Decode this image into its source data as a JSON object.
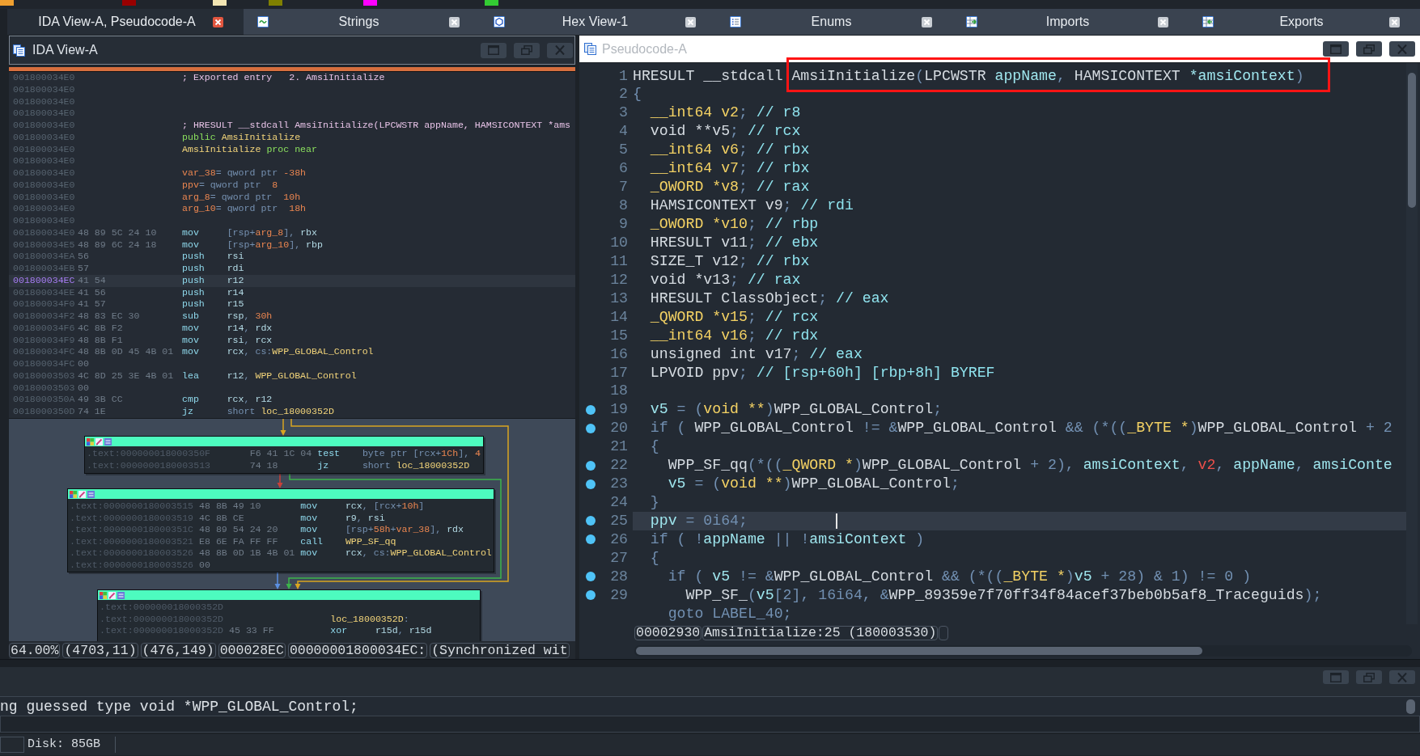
{
  "legend": [
    {
      "color": "#f0a030"
    },
    {
      "color": "#990000"
    },
    {
      "color": "#f3e6b3"
    },
    {
      "color": "#808000"
    },
    {
      "color": "#ff00ff"
    },
    {
      "color": "#33cc33"
    }
  ],
  "tabs": [
    {
      "label": "IDA View-A, Pseudocode-A",
      "kind": "plain",
      "selected": true
    },
    {
      "label": "Strings",
      "kind": "strings",
      "selected": false
    },
    {
      "label": "Hex View-1",
      "kind": "hex",
      "selected": false
    },
    {
      "label": "Enums",
      "kind": "enums",
      "selected": false
    },
    {
      "label": "Imports",
      "kind": "imports",
      "selected": false
    },
    {
      "label": "Exports",
      "kind": "exports",
      "selected": false
    }
  ],
  "disassembly": {
    "title": "IDA View-A",
    "listing": [
      {
        "address": "001800034E0",
        "code": [
          {
            "kind": "comment",
            "text": "; Exported entry   2. AmsiInitialize"
          }
        ],
        "selected": false
      },
      {
        "address": "001800034E0",
        "selected": false
      },
      {
        "address": "001800034E0",
        "selected": false
      },
      {
        "address": "001800034E0",
        "selected": false
      },
      {
        "address": "001800034E0",
        "code": [
          {
            "kind": "comment",
            "text": "; HRESULT __stdcall AmsiInitialize(LPCWSTR appName, HAMSICONTEXT *ams"
          }
        ],
        "selected": false
      },
      {
        "address": "001800034E0",
        "code": [
          {
            "kind": "dir",
            "text": "public "
          },
          {
            "kind": "name",
            "text": "AmsiInitialize"
          }
        ],
        "selected": false
      },
      {
        "address": "001800034E0",
        "code": [
          {
            "kind": "name",
            "text": "AmsiInitialize "
          },
          {
            "kind": "dir",
            "text": "proc near"
          }
        ],
        "selected": false
      },
      {
        "address": "001800034E0",
        "selected": false
      },
      {
        "address": "001800034E0",
        "code": [
          {
            "kind": "num",
            "text": "var_38"
          },
          {
            "kind": "kw",
            "text": "= qword ptr "
          },
          {
            "kind": "num",
            "text": "-38h"
          }
        ],
        "selected": false
      },
      {
        "address": "001800034E0",
        "code": [
          {
            "kind": "num",
            "text": "ppv"
          },
          {
            "kind": "kw",
            "text": "= qword ptr  "
          },
          {
            "kind": "num",
            "text": "8"
          }
        ],
        "selected": false
      },
      {
        "address": "001800034E0",
        "code": [
          {
            "kind": "num",
            "text": "arg_8"
          },
          {
            "kind": "kw",
            "text": "= qword ptr  "
          },
          {
            "kind": "num",
            "text": "10h"
          }
        ],
        "selected": false
      },
      {
        "address": "001800034E0",
        "code": [
          {
            "kind": "num",
            "text": "arg_10"
          },
          {
            "kind": "kw",
            "text": "= qword ptr  "
          },
          {
            "kind": "num",
            "text": "18h"
          }
        ],
        "selected": false
      },
      {
        "address": "001800034E0",
        "selected": false
      },
      {
        "address": "001800034E0",
        "bytes": "48 89 5C 24 10",
        "code": [
          {
            "kind": "mnem",
            "text": "mov"
          },
          {
            "kind": "kw",
            "text": "[rsp+"
          },
          {
            "kind": "num",
            "text": "arg_8"
          },
          {
            "kind": "kw",
            "text": "], "
          },
          {
            "kind": "reg",
            "text": "rbx"
          }
        ],
        "selected": false
      },
      {
        "address": "001800034E5",
        "bytes": "48 89 6C 24 18",
        "code": [
          {
            "kind": "mnem",
            "text": "mov"
          },
          {
            "kind": "kw",
            "text": "[rsp+"
          },
          {
            "kind": "num",
            "text": "arg_10"
          },
          {
            "kind": "kw",
            "text": "], "
          },
          {
            "kind": "reg",
            "text": "rbp"
          }
        ],
        "selected": false
      },
      {
        "address": "001800034EA",
        "bytes": "56",
        "code": [
          {
            "kind": "mnem",
            "text": "push"
          },
          {
            "kind": "reg",
            "text": "rsi"
          }
        ],
        "selected": false
      },
      {
        "address": "001800034EB",
        "bytes": "57",
        "code": [
          {
            "kind": "mnem",
            "text": "push"
          },
          {
            "kind": "reg",
            "text": "rdi"
          }
        ],
        "selected": false
      },
      {
        "address": "001800034EC",
        "bytes": "41 54",
        "code": [
          {
            "kind": "mnem",
            "text": "push"
          },
          {
            "kind": "reg",
            "text": "r12"
          }
        ],
        "selected": true
      },
      {
        "address": "001800034EE",
        "bytes": "41 56",
        "code": [
          {
            "kind": "mnem",
            "text": "push"
          },
          {
            "kind": "reg",
            "text": "r14"
          }
        ],
        "selected": false
      },
      {
        "address": "001800034F0",
        "bytes": "41 57",
        "code": [
          {
            "kind": "mnem",
            "text": "push"
          },
          {
            "kind": "reg",
            "text": "r15"
          }
        ],
        "selected": false
      },
      {
        "address": "001800034F2",
        "bytes": "48 83 EC 30",
        "code": [
          {
            "kind": "mnem",
            "text": "sub"
          },
          {
            "kind": "reg",
            "text": "rsp"
          },
          {
            "kind": "kw",
            "text": ", "
          },
          {
            "kind": "num",
            "text": "30h"
          }
        ],
        "selected": false
      },
      {
        "address": "001800034F6",
        "bytes": "4C 8B F2",
        "code": [
          {
            "kind": "mnem",
            "text": "mov"
          },
          {
            "kind": "reg",
            "text": "r14"
          },
          {
            "kind": "kw",
            "text": ", "
          },
          {
            "kind": "reg",
            "text": "rdx"
          }
        ],
        "selected": false
      },
      {
        "address": "001800034F9",
        "bytes": "48 8B F1",
        "code": [
          {
            "kind": "mnem",
            "text": "mov"
          },
          {
            "kind": "reg",
            "text": "rsi"
          },
          {
            "kind": "kw",
            "text": ", "
          },
          {
            "kind": "reg",
            "text": "rcx"
          }
        ],
        "selected": false
      },
      {
        "address": "001800034FC",
        "bytes": "48 8B 0D 45 4B 01",
        "code": [
          {
            "kind": "mnem",
            "text": "mov"
          },
          {
            "kind": "reg",
            "text": "rcx"
          },
          {
            "kind": "kw",
            "text": ", cs:"
          },
          {
            "kind": "name",
            "text": "WPP_GLOBAL_Control"
          }
        ],
        "selected": false
      },
      {
        "address": "001800034FC",
        "bytes": "00",
        "selected": false
      },
      {
        "address": "00180003503",
        "bytes": "4C 8D 25 3E 4B 01",
        "code": [
          {
            "kind": "mnem",
            "text": "lea"
          },
          {
            "kind": "reg",
            "text": "r12"
          },
          {
            "kind": "kw",
            "text": ", "
          },
          {
            "kind": "name",
            "text": "WPP_GLOBAL_Control"
          }
        ],
        "selected": false
      },
      {
        "address": "00180003503",
        "bytes": "00",
        "selected": false
      },
      {
        "address": "0018000350A",
        "bytes": "49 3B CC",
        "code": [
          {
            "kind": "mnem",
            "text": "cmp"
          },
          {
            "kind": "reg",
            "text": "rcx"
          },
          {
            "kind": "kw",
            "text": ", "
          },
          {
            "kind": "reg",
            "text": "r12"
          }
        ],
        "selected": false
      },
      {
        "address": "0018000350D",
        "bytes": "74 1E",
        "code": [
          {
            "kind": "mnem",
            "text": "jz"
          },
          {
            "kind": "kw",
            "text": "short "
          },
          {
            "kind": "name",
            "text": "loc_18000352D"
          }
        ],
        "selected": false
      }
    ],
    "graph": {
      "blocks": [
        {
          "lines": [
            {
              "address": ".text:000000018000350F",
              "bytes": "F6 41 1C 04",
              "code": [
                {
                  "kind": "mnem",
                  "text": "test"
                },
                {
                  "kind": "kw",
                  "text": "byte ptr [rcx+"
                },
                {
                  "kind": "num",
                  "text": "1Ch"
                },
                {
                  "kind": "kw",
                  "text": "], "
                },
                {
                  "kind": "num",
                  "text": "4"
                }
              ]
            },
            {
              "address": ".text:0000000180003513",
              "bytes": "74 18",
              "code": [
                {
                  "kind": "mnem",
                  "text": "jz"
                },
                {
                  "kind": "kw",
                  "text": "short "
                },
                {
                  "kind": "name",
                  "text": "loc_18000352D"
                }
              ]
            }
          ]
        },
        {
          "lines": [
            {
              "address": ".text:0000000180003515",
              "bytes": "48 8B 49 10",
              "code": [
                {
                  "kind": "mnem",
                  "text": "mov"
                },
                {
                  "kind": "reg",
                  "text": "rcx"
                },
                {
                  "kind": "kw",
                  "text": ", [rcx+"
                },
                {
                  "kind": "num",
                  "text": "10h"
                },
                {
                  "kind": "kw",
                  "text": "]"
                }
              ]
            },
            {
              "address": ".text:0000000180003519",
              "bytes": "4C 8B CE",
              "code": [
                {
                  "kind": "mnem",
                  "text": "mov"
                },
                {
                  "kind": "reg",
                  "text": "r9"
                },
                {
                  "kind": "kw",
                  "text": ", "
                },
                {
                  "kind": "reg",
                  "text": "rsi"
                }
              ]
            },
            {
              "address": ".text:000000018000351C",
              "bytes": "48 89 54 24 20",
              "code": [
                {
                  "kind": "mnem",
                  "text": "mov"
                },
                {
                  "kind": "kw",
                  "text": "[rsp+"
                },
                {
                  "kind": "num",
                  "text": "58h"
                },
                {
                  "kind": "kw",
                  "text": "+"
                },
                {
                  "kind": "num",
                  "text": "var_38"
                },
                {
                  "kind": "kw",
                  "text": "], "
                },
                {
                  "kind": "reg",
                  "text": "rdx"
                }
              ]
            },
            {
              "address": ".text:0000000180003521",
              "bytes": "E8 6E FA FF FF",
              "code": [
                {
                  "kind": "mnem",
                  "text": "call"
                },
                {
                  "kind": "name",
                  "text": "WPP_SF_qq"
                }
              ]
            },
            {
              "address": ".text:0000000180003526",
              "bytes": "48 8B 0D 1B 4B 01",
              "code": [
                {
                  "kind": "mnem",
                  "text": "mov"
                },
                {
                  "kind": "reg",
                  "text": "rcx"
                },
                {
                  "kind": "kw",
                  "text": ", cs:"
                },
                {
                  "kind": "name",
                  "text": "WPP_GLOBAL_Control"
                }
              ]
            },
            {
              "address": ".text:0000000180003526",
              "bytes": "00"
            }
          ]
        },
        {
          "lines": [
            {
              "address": ".text:000000018000352D"
            },
            {
              "address": ".text:000000018000352D",
              "code": [
                {
                  "kind": "name",
                  "text": "loc_18000352D"
                },
                {
                  "kind": "kw",
                  "text": ":"
                }
              ]
            },
            {
              "address": ".text:000000018000352D",
              "bytes": "45 33 FF",
              "code": [
                {
                  "kind": "mnem",
                  "text": "xor"
                },
                {
                  "kind": "reg",
                  "text": "r15d"
                },
                {
                  "kind": "kw",
                  "text": ", "
                },
                {
                  "kind": "reg",
                  "text": "r15d"
                }
              ]
            }
          ]
        }
      ]
    },
    "status": [
      "64.00%",
      "(4703,11)",
      "(476,149)",
      "000028EC",
      "00000001800034EC:",
      "(Synchronized wit"
    ]
  },
  "pseudocode": {
    "title": "Pseudocode-A",
    "lines": [
      {
        "number": "1",
        "marker": false,
        "selected": false,
        "code": [
          {
            "kind": "plain",
            "text": "HRESULT __stdcall AmsiInitialize"
          },
          {
            "kind": "op",
            "text": "("
          },
          {
            "kind": "plain",
            "text": "LPCWSTR "
          },
          {
            "kind": "var",
            "text": "appName"
          },
          {
            "kind": "op",
            "text": ", "
          },
          {
            "kind": "plain",
            "text": "HAMSICONTEXT "
          },
          {
            "kind": "var",
            "text": "*amsiContext"
          },
          {
            "kind": "op",
            "text": ")"
          }
        ]
      },
      {
        "number": "2",
        "marker": false,
        "selected": false,
        "code": [
          {
            "kind": "op",
            "text": "{"
          }
        ]
      },
      {
        "number": "3",
        "marker": false,
        "selected": false,
        "code": [
          {
            "kind": "type",
            "text": "  __int64 v2"
          },
          {
            "kind": "op",
            "text": "; "
          },
          {
            "kind": "comment",
            "text": "// r8"
          }
        ]
      },
      {
        "number": "4",
        "marker": false,
        "selected": false,
        "code": [
          {
            "kind": "plain",
            "text": "  void **v5"
          },
          {
            "kind": "op",
            "text": "; "
          },
          {
            "kind": "comment",
            "text": "// rcx"
          }
        ]
      },
      {
        "number": "5",
        "marker": false,
        "selected": false,
        "code": [
          {
            "kind": "type",
            "text": "  __int64 v6"
          },
          {
            "kind": "op",
            "text": "; "
          },
          {
            "kind": "comment",
            "text": "// rbx"
          }
        ]
      },
      {
        "number": "6",
        "marker": false,
        "selected": false,
        "code": [
          {
            "kind": "type",
            "text": "  __int64 v7"
          },
          {
            "kind": "op",
            "text": "; "
          },
          {
            "kind": "comment",
            "text": "// rbx"
          }
        ]
      },
      {
        "number": "7",
        "marker": false,
        "selected": false,
        "code": [
          {
            "kind": "type",
            "text": "  _OWORD *v8"
          },
          {
            "kind": "op",
            "text": "; "
          },
          {
            "kind": "comment",
            "text": "// rax"
          }
        ]
      },
      {
        "number": "8",
        "marker": false,
        "selected": false,
        "code": [
          {
            "kind": "plain",
            "text": "  HAMSICONTEXT v9"
          },
          {
            "kind": "op",
            "text": "; "
          },
          {
            "kind": "comment",
            "text": "// rdi"
          }
        ]
      },
      {
        "number": "9",
        "marker": false,
        "selected": false,
        "code": [
          {
            "kind": "type",
            "text": "  _OWORD *v10"
          },
          {
            "kind": "op",
            "text": "; "
          },
          {
            "kind": "comment",
            "text": "// rbp"
          }
        ]
      },
      {
        "number": "10",
        "marker": false,
        "selected": false,
        "code": [
          {
            "kind": "plain",
            "text": "  HRESULT v11"
          },
          {
            "kind": "op",
            "text": "; "
          },
          {
            "kind": "comment",
            "text": "// ebx"
          }
        ]
      },
      {
        "number": "11",
        "marker": false,
        "selected": false,
        "code": [
          {
            "kind": "plain",
            "text": "  SIZE_T v12"
          },
          {
            "kind": "op",
            "text": "; "
          },
          {
            "kind": "comment",
            "text": "// rbx"
          }
        ]
      },
      {
        "number": "12",
        "marker": false,
        "selected": false,
        "code": [
          {
            "kind": "plain",
            "text": "  void *v13"
          },
          {
            "kind": "op",
            "text": "; "
          },
          {
            "kind": "comment",
            "text": "// rax"
          }
        ]
      },
      {
        "number": "13",
        "marker": false,
        "selected": false,
        "code": [
          {
            "kind": "plain",
            "text": "  HRESULT ClassObject"
          },
          {
            "kind": "op",
            "text": "; "
          },
          {
            "kind": "comment",
            "text": "// eax"
          }
        ]
      },
      {
        "number": "14",
        "marker": false,
        "selected": false,
        "code": [
          {
            "kind": "type",
            "text": "  _QWORD *v15"
          },
          {
            "kind": "op",
            "text": "; "
          },
          {
            "kind": "comment",
            "text": "// rcx"
          }
        ]
      },
      {
        "number": "15",
        "marker": false,
        "selected": false,
        "code": [
          {
            "kind": "type",
            "text": "  __int64 v16"
          },
          {
            "kind": "op",
            "text": "; "
          },
          {
            "kind": "comment",
            "text": "// rdx"
          }
        ]
      },
      {
        "number": "16",
        "marker": false,
        "selected": false,
        "code": [
          {
            "kind": "plain",
            "text": "  unsigned int v17"
          },
          {
            "kind": "op",
            "text": "; "
          },
          {
            "kind": "comment",
            "text": "// eax"
          }
        ]
      },
      {
        "number": "17",
        "marker": false,
        "selected": false,
        "code": [
          {
            "kind": "plain",
            "text": "  LPVOID ppv"
          },
          {
            "kind": "op",
            "text": "; "
          },
          {
            "kind": "comment",
            "text": "// [rsp+60h] [rbp+8h] BYREF"
          }
        ]
      },
      {
        "number": "18",
        "marker": false,
        "selected": false
      },
      {
        "number": "19",
        "marker": true,
        "selected": false,
        "code": [
          {
            "kind": "var",
            "text": "  v5"
          },
          {
            "kind": "op",
            "text": " = ("
          },
          {
            "kind": "type",
            "text": "void **"
          },
          {
            "kind": "op",
            "text": ")"
          },
          {
            "kind": "plain",
            "text": "WPP_GLOBAL_Control"
          },
          {
            "kind": "op",
            "text": ";"
          }
        ]
      },
      {
        "number": "20",
        "marker": true,
        "selected": false,
        "code": [
          {
            "kind": "op",
            "text": "  if ( "
          },
          {
            "kind": "plain",
            "text": "WPP_GLOBAL_Control"
          },
          {
            "kind": "op",
            "text": " != &"
          },
          {
            "kind": "plain",
            "text": "WPP_GLOBAL_Control"
          },
          {
            "kind": "op",
            "text": " && (*(("
          },
          {
            "kind": "type",
            "text": "_BYTE *"
          },
          {
            "kind": "op",
            "text": ")"
          },
          {
            "kind": "plain",
            "text": "WPP_GLOBAL_Control"
          },
          {
            "kind": "op",
            "text": " + 2"
          }
        ]
      },
      {
        "number": "21",
        "marker": false,
        "selected": false,
        "code": [
          {
            "kind": "op",
            "text": "  {"
          }
        ]
      },
      {
        "number": "22",
        "marker": true,
        "selected": false,
        "code": [
          {
            "kind": "plain",
            "text": "    WPP_SF_qq"
          },
          {
            "kind": "op",
            "text": "(*(("
          },
          {
            "kind": "type",
            "text": "_QWORD *"
          },
          {
            "kind": "op",
            "text": ")"
          },
          {
            "kind": "plain",
            "text": "WPP_GLOBAL_Control"
          },
          {
            "kind": "op",
            "text": " + 2), "
          },
          {
            "kind": "var",
            "text": "amsiContext"
          },
          {
            "kind": "op",
            "text": ", "
          },
          {
            "kind": "warn",
            "text": "v2"
          },
          {
            "kind": "op",
            "text": ", "
          },
          {
            "kind": "var",
            "text": "appName"
          },
          {
            "kind": "op",
            "text": ", "
          },
          {
            "kind": "var",
            "text": "amsiConte"
          }
        ]
      },
      {
        "number": "23",
        "marker": true,
        "selected": false,
        "code": [
          {
            "kind": "var",
            "text": "    v5"
          },
          {
            "kind": "op",
            "text": " = ("
          },
          {
            "kind": "type",
            "text": "void **"
          },
          {
            "kind": "op",
            "text": ")"
          },
          {
            "kind": "plain",
            "text": "WPP_GLOBAL_Control"
          },
          {
            "kind": "op",
            "text": ";"
          }
        ]
      },
      {
        "number": "24",
        "marker": false,
        "selected": false,
        "code": [
          {
            "kind": "op",
            "text": "  }"
          }
        ]
      },
      {
        "number": "25",
        "marker": true,
        "selected": true,
        "code": [
          {
            "kind": "var",
            "text": "  ppv"
          },
          {
            "kind": "op",
            "text": " = 0i64;"
          }
        ]
      },
      {
        "number": "26",
        "marker": true,
        "selected": false,
        "code": [
          {
            "kind": "op",
            "text": "  if ( !"
          },
          {
            "kind": "var",
            "text": "appName"
          },
          {
            "kind": "op",
            "text": " || !"
          },
          {
            "kind": "var",
            "text": "amsiContext"
          },
          {
            "kind": "op",
            "text": " )"
          }
        ]
      },
      {
        "number": "27",
        "marker": false,
        "selected": false,
        "code": [
          {
            "kind": "op",
            "text": "  {"
          }
        ]
      },
      {
        "number": "28",
        "marker": true,
        "selected": false,
        "code": [
          {
            "kind": "op",
            "text": "    if ( "
          },
          {
            "kind": "var",
            "text": "v5"
          },
          {
            "kind": "op",
            "text": " != &"
          },
          {
            "kind": "plain",
            "text": "WPP_GLOBAL_Control"
          },
          {
            "kind": "op",
            "text": " && (*(("
          },
          {
            "kind": "type",
            "text": "_BYTE *"
          },
          {
            "kind": "op",
            "text": ")"
          },
          {
            "kind": "var",
            "text": "v5"
          },
          {
            "kind": "op",
            "text": " + 28) & 1) != 0 )"
          }
        ]
      },
      {
        "number": "29",
        "marker": true,
        "selected": false,
        "code": [
          {
            "kind": "plain",
            "text": "      WPP_SF_"
          },
          {
            "kind": "op",
            "text": "("
          },
          {
            "kind": "var",
            "text": "v5"
          },
          {
            "kind": "op",
            "text": "[2], 16i64, &"
          },
          {
            "kind": "plain",
            "text": "WPP_89359e7f70ff34f84acef37beb0b5af8_Traceguids"
          },
          {
            "kind": "op",
            "text": ");"
          }
        ]
      },
      {
        "marker": false,
        "selected": false,
        "code": [
          {
            "kind": "op",
            "text": "    goto LABEL_40;"
          }
        ]
      }
    ],
    "status": [
      "00002930",
      "AmsiInitialize:25 (180003530)"
    ]
  },
  "output": {
    "text": "ng guessed type void *WPP_GLOBAL_Control;"
  },
  "status_bar": {
    "disk": "Disk: 85GB"
  }
}
